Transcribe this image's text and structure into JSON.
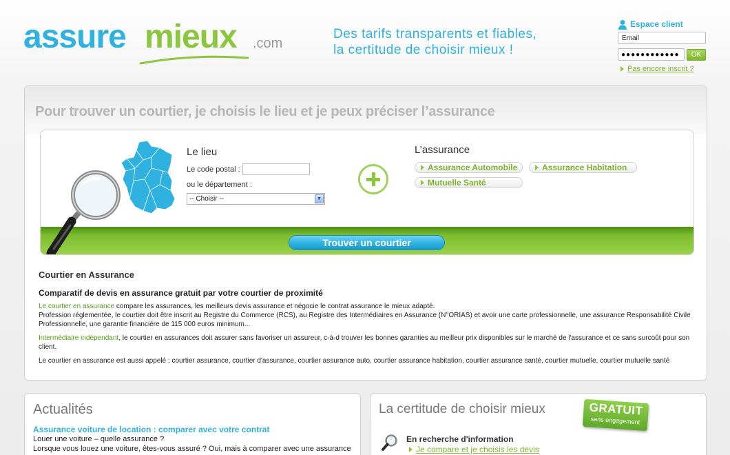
{
  "logo": {
    "part1": "assure",
    "part2": "mieux",
    "suffix": ".com"
  },
  "tagline": {
    "line1": "Des tarifs transparents et fiables,",
    "line2": "la certitude de choisir mieux !"
  },
  "client": {
    "title": "Espace client",
    "email_value": "Email",
    "password_value": "●●●●●●●●●●●●",
    "ok_label": "OK",
    "register_link": "Pas encore inscrit ?"
  },
  "search": {
    "headline": "Pour trouver un courtier,  je choisis le lieu et je peux préciser l’assurance",
    "lieu_title": "Le lieu",
    "postal_label": "Le code postal :",
    "dept_label": "ou le département  :",
    "dept_selected": "-- Choisir --",
    "assurance_title": "L’assurance",
    "options": [
      "Assurance Automobile",
      "Assurance Habitation",
      "Mutuelle Santé"
    ],
    "button": "Trouver un courtier"
  },
  "content": {
    "heading": "Courtier en Assurance",
    "subheading": "Comparatif de devis en assurance gratuit par votre courtier de proximité",
    "p1_highlight": "Le courtier en assurance",
    "p1_text": " compare les assurances, les meilleurs devis assurance et négocie le contrat assurance le mieux adapté.",
    "p1_line2": "Profession réglementée, le courtier doit être inscrit au Registre du Commerce (RCS), au Registre des Intermédiaires en Assurance (N°ORIAS) et avoir une carte professionnelle, une assurance Responsabilité Civile Professionnelle, une garantie financière de 115 000 euros minimum...",
    "p2_highlight": "Intermédiaire indépendant",
    "p2_text": ", le courtier en assurances doit assurer sans favoriser un assureur, c-à-d trouver les bonnes garanties au meilleur prix disponibles sur le marché de l'assurance et ce sans surcoût pour son client.",
    "p3_text": "Le courtier en assurance est aussi appelé : courtier assurance, courtier d'assurance, courtier assurance auto, courtier assurance habitation, courtier assurance santé, courtier mutuelle, courtier mutuelle santé"
  },
  "actualites": {
    "title": "Actualités",
    "link": "Assurance voiture de location : comparer avec votre contrat",
    "line1": "Louer une voiture – quelle assurance ?",
    "line2": "Lorsque vous louez une voiture, êtes-vous assuré ? Oui, mais à comparer avec une assurance"
  },
  "certitude": {
    "title": "La certitude de choisir mieux",
    "badge_big": "GRATUIT",
    "badge_small": "sans engagement",
    "label": "En recherche d'information",
    "link": "Je compare et je choisis les devis"
  },
  "colors": {
    "blue": "#2fb2e0",
    "green": "#8cc63e",
    "dark_green": "#559a16"
  }
}
